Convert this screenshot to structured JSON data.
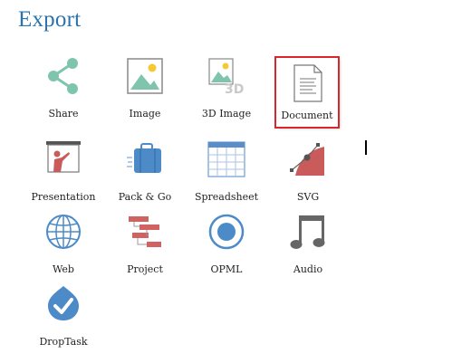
{
  "page": {
    "title": "Export"
  },
  "colors": {
    "accent": "#2a73ad",
    "selection": "#d9262b"
  },
  "export_options": [
    {
      "label": "Share",
      "icon": "share-icon",
      "selected": false
    },
    {
      "label": "Image",
      "icon": "image-icon",
      "selected": false
    },
    {
      "label": "3D Image",
      "icon": "3d-image-icon",
      "selected": false,
      "icon_text": "3D"
    },
    {
      "label": "Document",
      "icon": "document-icon",
      "selected": true
    },
    {
      "label": "Presentation",
      "icon": "presentation-icon",
      "selected": false
    },
    {
      "label": "Pack & Go",
      "icon": "suitcase-icon",
      "selected": false
    },
    {
      "label": "Spreadsheet",
      "icon": "spreadsheet-icon",
      "selected": false
    },
    {
      "label": "SVG",
      "icon": "svg-icon",
      "selected": false
    },
    {
      "label": "Web",
      "icon": "globe-icon",
      "selected": false
    },
    {
      "label": "Project",
      "icon": "gantt-icon",
      "selected": false
    },
    {
      "label": "OPML",
      "icon": "opml-icon",
      "selected": false
    },
    {
      "label": "Audio",
      "icon": "music-note-icon",
      "selected": false
    },
    {
      "label": "DropTask",
      "icon": "droptask-icon",
      "selected": false
    }
  ]
}
